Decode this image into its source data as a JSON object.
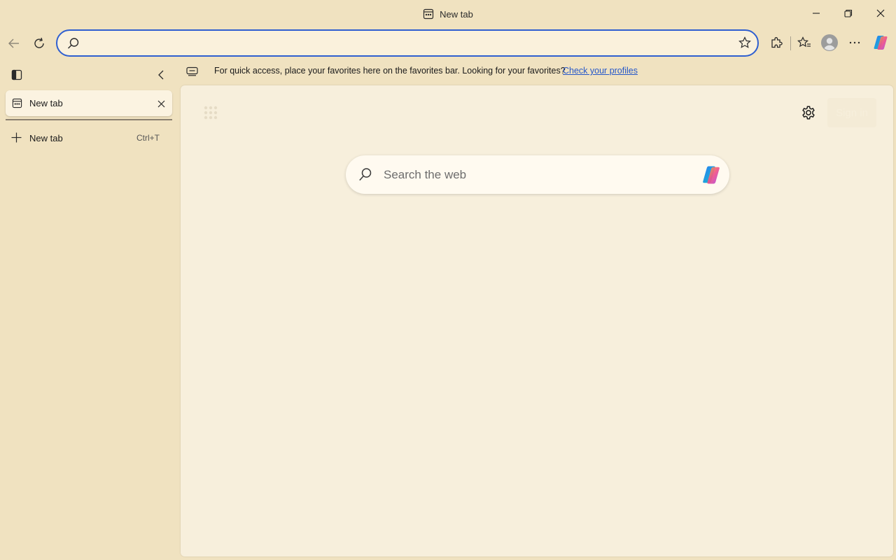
{
  "window": {
    "title": "New tab"
  },
  "address_bar": {
    "value": "",
    "placeholder": ""
  },
  "favorites_bar": {
    "message": "For quick access, place your favorites here on the favorites bar. Looking for your favorites?",
    "link_label": "Check your profiles"
  },
  "sidebar": {
    "tabs": [
      {
        "label": "New tab"
      }
    ],
    "new_tab": {
      "label": "New tab",
      "shortcut": "Ctrl+T"
    }
  },
  "new_tab_page": {
    "search_placeholder": "Search the web",
    "sign_in_label": "Sign in"
  },
  "colors": {
    "frame_background": "#f0e2c0",
    "content_background": "#f7efdc",
    "address_bar_focus": "#2f5fd0",
    "link": "#2557c9"
  },
  "icons": [
    "new-tab-page-icon",
    "minimize-icon",
    "restore-icon",
    "close-icon",
    "back-icon",
    "refresh-icon",
    "search-icon",
    "favorite-star-icon",
    "extensions-icon",
    "favorites-icon",
    "profile-avatar-icon",
    "more-icon",
    "copilot-icon",
    "vertical-tabs-icon",
    "collapse-chevron-icon",
    "favorites-bar-icon",
    "tab-close-icon",
    "plus-icon",
    "app-launcher-icon",
    "settings-gear-icon"
  ]
}
